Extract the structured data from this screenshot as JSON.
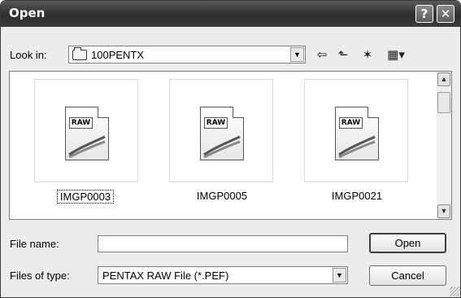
{
  "window": {
    "title": "Open",
    "help_glyph": "?",
    "close_glyph": "✕"
  },
  "look_in": {
    "label": "Look in:",
    "value": "100PENTX",
    "dropdown_glyph": "▼"
  },
  "toolbar": {
    "back_glyph": "⇦",
    "up_glyph": "⬑",
    "newfolder_glyph": "✶",
    "views_glyph": "▦▾"
  },
  "files": [
    {
      "name": "IMGP0003",
      "badge": "RAW",
      "selected": true
    },
    {
      "name": "IMGP0005",
      "badge": "RAW",
      "selected": false
    },
    {
      "name": "IMGP0021",
      "badge": "RAW",
      "selected": false
    }
  ],
  "scrollbar": {
    "up_glyph": "▲",
    "down_glyph": "▼"
  },
  "file_name": {
    "label": "File name:",
    "value": ""
  },
  "file_type": {
    "label": "Files of type:",
    "value": "PENTAX RAW File (*.PEF)",
    "dropdown_glyph": "▼"
  },
  "buttons": {
    "open": "Open",
    "cancel": "Cancel"
  },
  "icons": {
    "title_help": "help-icon",
    "title_close": "close-icon",
    "folder": "folder-icon",
    "back": "back-icon",
    "up": "up-folder-icon",
    "new_folder": "new-folder-icon",
    "views": "views-menu-icon",
    "file": "raw-file-icon"
  }
}
